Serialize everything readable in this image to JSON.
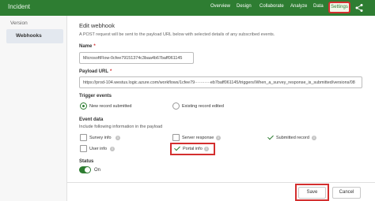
{
  "header": {
    "app_title": "Incident",
    "nav": {
      "overview": "Overview",
      "design": "Design",
      "collaborate": "Collaborate",
      "analyze": "Analyze",
      "data": "Data",
      "settings": "Settings"
    },
    "brand_color": "#2e7d32"
  },
  "sidebar": {
    "version_label": "Version",
    "webhooks_label": "Webhooks"
  },
  "form": {
    "title": "Edit webhook",
    "description": "A POST request will be sent to the payload URL below with selected details of any subscribed events.",
    "name_label": "Name",
    "name_value": "MicrosoftFlow-0cfee79151374c3baa4b67baff061145",
    "url_label": "Payload URL",
    "url_value": "https://prod-104.westus.logic.azure.com/workflows/1cfee79···········eb7baff061145/triggers/When_a_survey_response_is_submitted/versions/08",
    "required_mark": "*",
    "trigger_label": "Trigger events",
    "trigger_new": "New record submitted",
    "trigger_existing": "Existing record edited",
    "event_data_label": "Event data",
    "event_data_desc": "Include following information in the payload",
    "survey_info": "Survey info",
    "server_response": "Server response",
    "submitted_record": "Submitted record",
    "user_info": "User info",
    "portal_info": "Portal info",
    "info_glyph": "i",
    "status_label": "Status",
    "status_value": "On",
    "save": "Save",
    "cancel": "Cancel"
  }
}
